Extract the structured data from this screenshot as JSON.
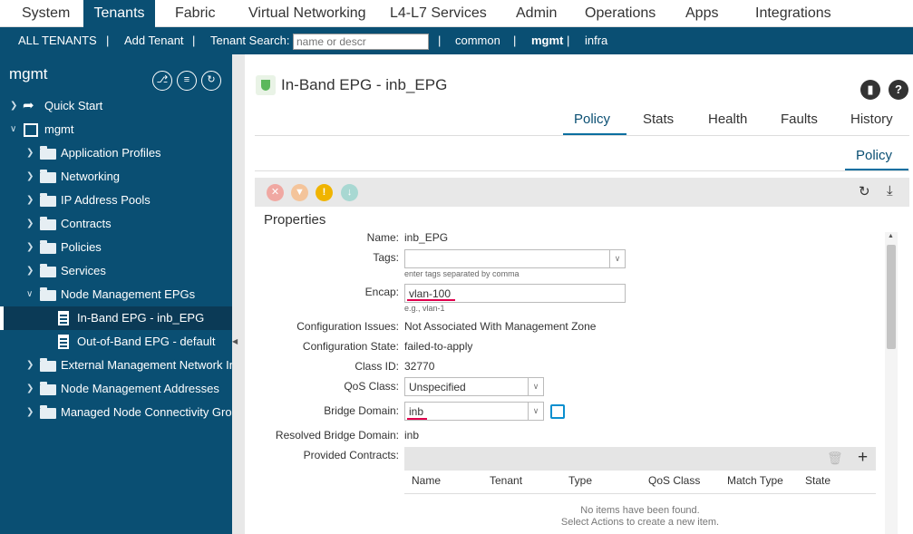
{
  "top_tabs": [
    "System",
    "Tenants",
    "Fabric",
    "Virtual Networking",
    "L4-L7 Services",
    "Admin",
    "Operations",
    "Apps",
    "Integrations"
  ],
  "subnav": {
    "all_tenants": "ALL TENANTS",
    "sep": "|",
    "add_tenant": "Add Tenant",
    "search_label": "Tenant Search:",
    "search_placeholder": "name or descr",
    "common": "common",
    "mgmt": "mgmt",
    "infra": "infra"
  },
  "sidebar": {
    "title": "mgmt",
    "tools": [
      "filter-icon",
      "list-icon",
      "refresh-icon"
    ],
    "items": [
      {
        "label": "Quick Start"
      },
      {
        "label": "mgmt"
      },
      {
        "label": "Application Profiles"
      },
      {
        "label": "Networking"
      },
      {
        "label": "IP Address Pools"
      },
      {
        "label": "Contracts"
      },
      {
        "label": "Policies"
      },
      {
        "label": "Services"
      },
      {
        "label": "Node Management EPGs"
      },
      {
        "label": "In-Band EPG - inb_EPG"
      },
      {
        "label": "Out-of-Band EPG - default"
      },
      {
        "label": "External Management Network Instance Profiles"
      },
      {
        "label": "Node Management Addresses"
      },
      {
        "label": "Managed Node Connectivity Groups"
      }
    ]
  },
  "main": {
    "title": "In-Band EPG - inb_EPG",
    "tabs": [
      "Policy",
      "Stats",
      "Health",
      "Faults",
      "History"
    ],
    "subtab": "Policy",
    "properties_title": "Properties",
    "fields": {
      "name_label": "Name:",
      "name_value": "inb_EPG",
      "tags_label": "Tags:",
      "tags_hint": "enter tags separated by comma",
      "encap_label": "Encap:",
      "encap_value": "vlan-100",
      "encap_hint": "e.g., vlan-1",
      "config_issues_label": "Configuration Issues:",
      "config_issues_value": "Not Associated With Management Zone",
      "config_state_label": "Configuration State:",
      "config_state_value": "failed-to-apply",
      "class_id_label": "Class ID:",
      "class_id_value": "32770",
      "qos_label": "QoS Class:",
      "qos_value": "Unspecified",
      "bd_label": "Bridge Domain:",
      "bd_value": "inb",
      "resolved_bd_label": "Resolved Bridge Domain:",
      "resolved_bd_value": "inb",
      "provided_contracts_label": "Provided Contracts:"
    },
    "contracts_table": {
      "columns": [
        "Name",
        "Tenant",
        "Type",
        "QoS Class",
        "Match Type",
        "State"
      ],
      "empty_line1": "No items have been found.",
      "empty_line2": "Select Actions to create a new item."
    }
  }
}
